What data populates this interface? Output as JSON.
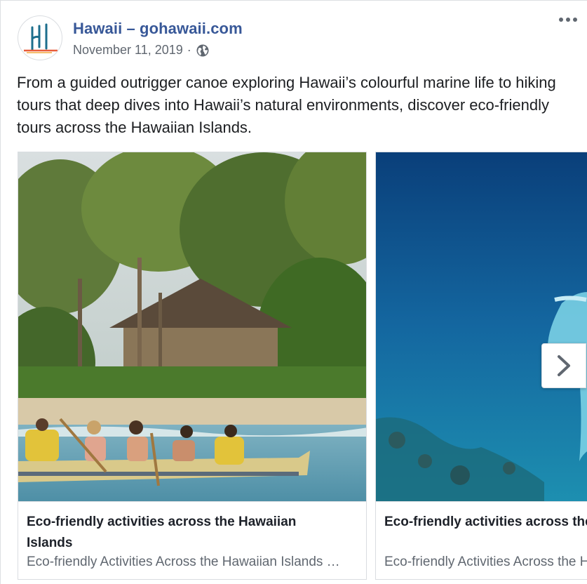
{
  "post": {
    "page_name": "Hawaii – gohawaii.com",
    "date": "November 11, 2019",
    "separator": "·",
    "privacy_icon": "globe-icon",
    "more_icon": "more-options-icon",
    "text": "From a guided outrigger canoe exploring Hawaii’s colourful marine life to hiking tours that deep dives into Hawaii’s natural environments, discover eco-friendly tours across the Hawaiian Islands."
  },
  "carousel": {
    "cards": [
      {
        "title": "Eco-friendly activities across the Hawaiian Islands",
        "subtitle": "Eco-friendly Activities Across the Hawaiian Islands …",
        "image": "outrigger-canoe-beach-photo"
      },
      {
        "title": "Eco-friendly activities across the Hawaiian Islands",
        "subtitle": "Eco-friendly Activities Across the Hawaiian Islands …",
        "image": "manta-ray-underwater-photo"
      }
    ],
    "next_icon": "chevron-right-icon"
  },
  "colors": {
    "page_name": "#385898",
    "meta_text": "#606770",
    "body_text": "#1c1e21",
    "border": "#dadde1"
  }
}
